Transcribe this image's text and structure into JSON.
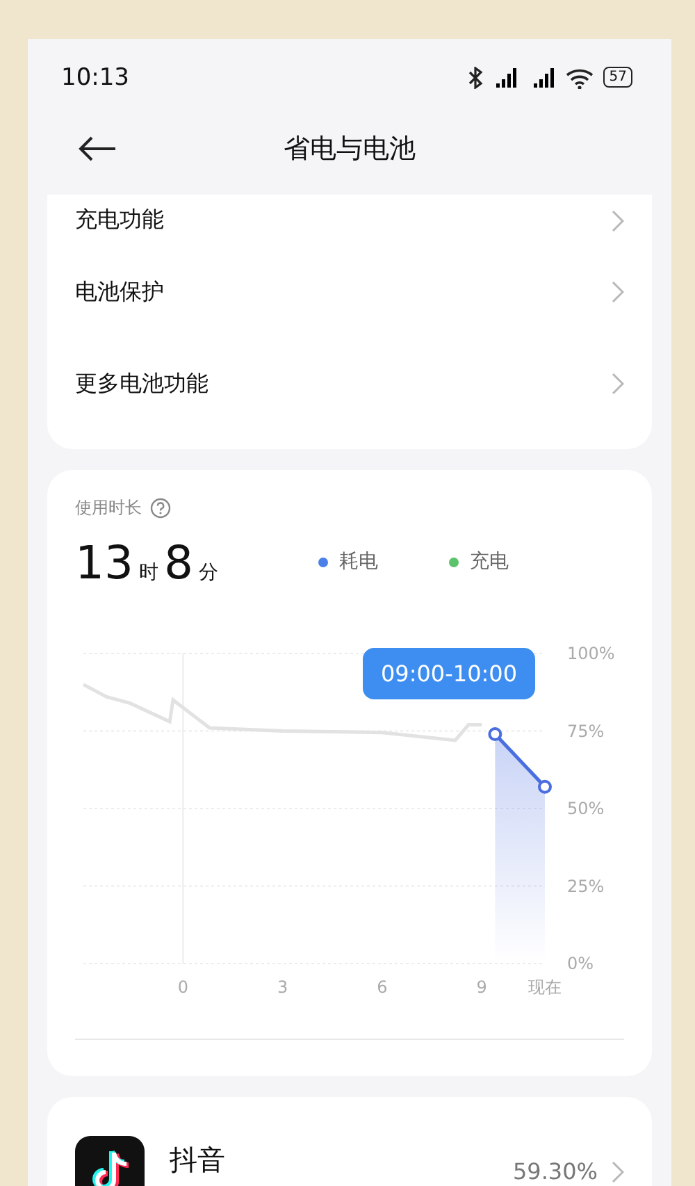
{
  "status_bar": {
    "time": "10:13",
    "battery": "57"
  },
  "header": {
    "title": "省电与电池"
  },
  "menu": [
    {
      "label": "充电功能"
    },
    {
      "label": "电池保护"
    },
    {
      "label": "更多电池功能"
    }
  ],
  "usage": {
    "title": "使用时长",
    "hours": "13",
    "hours_unit": "时",
    "minutes": "8",
    "minutes_unit": "分",
    "legend": [
      {
        "label": "耗电",
        "color": "#4a80e8"
      },
      {
        "label": "充电",
        "color": "#5cc36a"
      }
    ],
    "tooltip": "09:00-10:00",
    "chart_data": {
      "type": "line",
      "grid": true,
      "x": [
        -3,
        -2.3,
        -1.6,
        -0.4,
        -0.3,
        0.8,
        3,
        6,
        8.2,
        8.6,
        9,
        9.4,
        10.9
      ],
      "xlim": [
        -3,
        10.9
      ],
      "ylim": [
        0,
        100
      ],
      "xticks": [
        0,
        3,
        6,
        9,
        {
          "value": 10.9,
          "label": "现在"
        }
      ],
      "yticks": [
        {
          "value": 100,
          "label": "100%"
        },
        {
          "value": 75,
          "label": "75%"
        },
        {
          "value": 50,
          "label": "50%"
        },
        {
          "value": 25,
          "label": "25%"
        },
        {
          "value": 0,
          "label": "0%"
        }
      ],
      "series": [
        {
          "type": "line",
          "color": "#e2e2e2",
          "marker": false,
          "values": [
            90,
            86,
            84,
            78,
            85,
            76,
            75,
            74.5,
            72,
            77,
            77,
            null,
            null
          ]
        },
        {
          "type": "area",
          "color": "#4a6ee0",
          "marker": true,
          "values": [
            null,
            null,
            null,
            null,
            null,
            null,
            null,
            null,
            null,
            null,
            null,
            74,
            57
          ]
        }
      ]
    }
  },
  "apps": [
    {
      "name": "抖音",
      "percent": "59.30%"
    }
  ]
}
